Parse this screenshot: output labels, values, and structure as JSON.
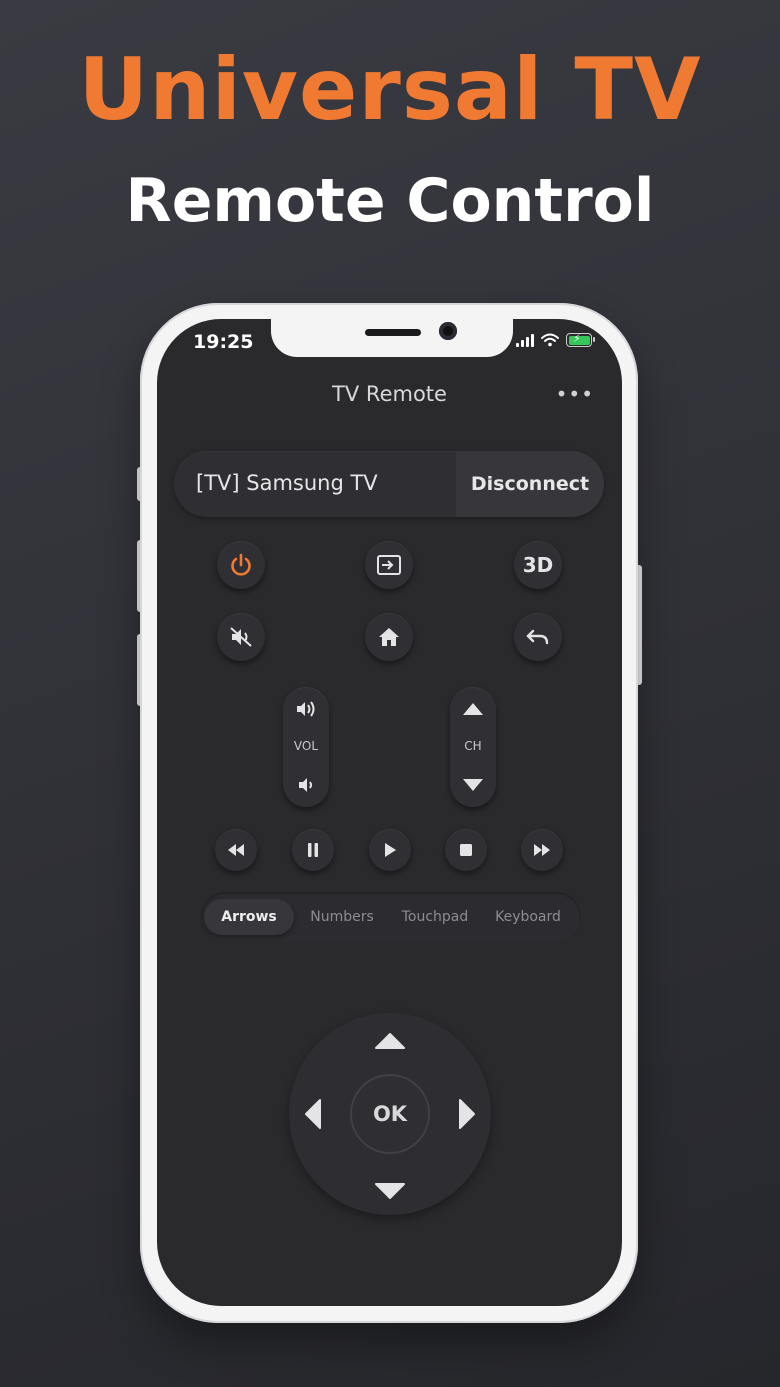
{
  "headline": {
    "line1": "Universal TV",
    "line2": "Remote Control",
    "accent": "#f07a32"
  },
  "status_bar": {
    "time": "19:25"
  },
  "app": {
    "title": "TV Remote",
    "more_label": "•••"
  },
  "device": {
    "name": "[TV] Samsung TV",
    "disconnect_label": "Disconnect"
  },
  "buttons": {
    "power": {
      "icon": "power-icon",
      "color": "#f07a32"
    },
    "input": {
      "icon": "input-source-icon"
    },
    "three_d": {
      "label": "3D"
    },
    "mute": {
      "icon": "mute-icon"
    },
    "home": {
      "icon": "home-icon"
    },
    "back": {
      "icon": "back-icon"
    }
  },
  "volume": {
    "label": "VOL"
  },
  "channel": {
    "label": "CH"
  },
  "media": [
    "rewind-icon",
    "pause-icon",
    "play-icon",
    "stop-icon",
    "fast-forward-icon"
  ],
  "tabs": [
    {
      "label": "Arrows",
      "active": true
    },
    {
      "label": "Numbers",
      "active": false
    },
    {
      "label": "Touchpad",
      "active": false
    },
    {
      "label": "Keyboard",
      "active": false
    }
  ],
  "dpad": {
    "ok_label": "OK"
  }
}
